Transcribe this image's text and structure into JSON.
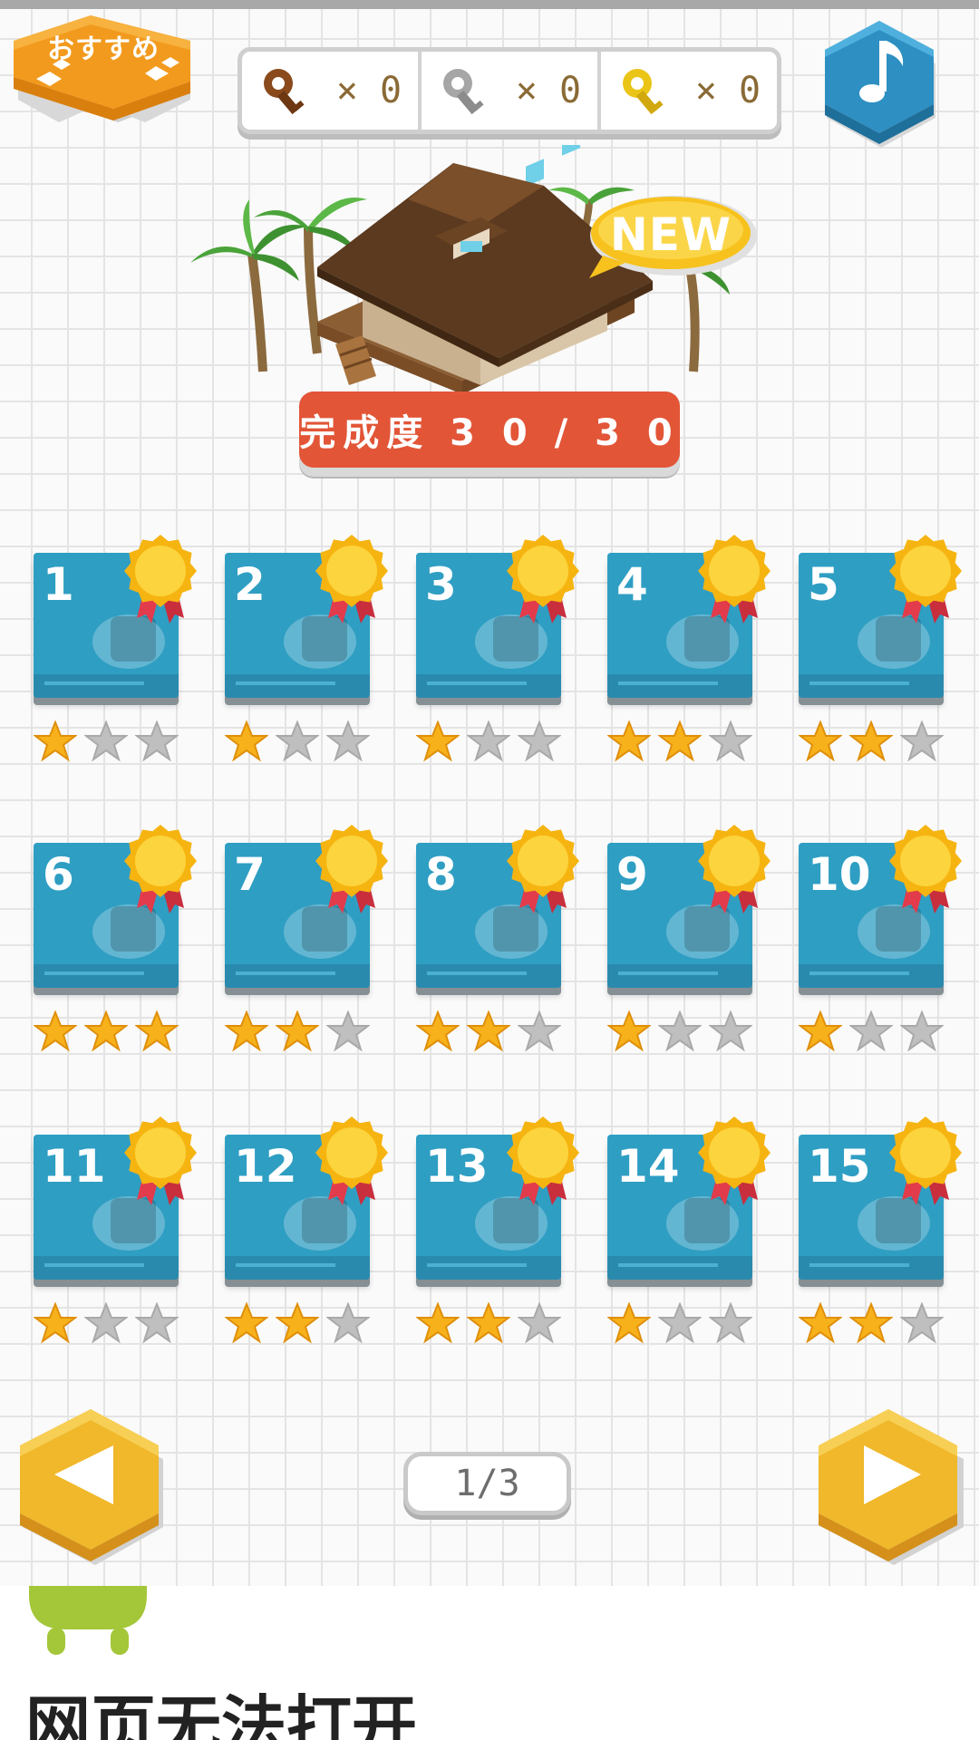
{
  "header": {
    "recommend_label": "おすすめ",
    "keys": [
      {
        "name": "bronze-key",
        "color": "#8a4a1c",
        "count": "× 0"
      },
      {
        "name": "silver-key",
        "color": "#9a9a9a",
        "count": "× 0"
      },
      {
        "name": "gold-key",
        "color": "#e8c21a",
        "count": "× 0"
      }
    ],
    "music_icon": "music-note-icon"
  },
  "hero": {
    "new_badge": "NEW",
    "completion": "完成度 3 0 / 3 0"
  },
  "levels": [
    {
      "num": "1",
      "stars": 1,
      "item": "beach-table"
    },
    {
      "num": "2",
      "stars": 1,
      "item": "hula-dancer"
    },
    {
      "num": "3",
      "stars": 1,
      "item": "rubber-duck"
    },
    {
      "num": "4",
      "stars": 2,
      "item": "parrot-cage"
    },
    {
      "num": "5",
      "stars": 2,
      "item": "boombox"
    },
    {
      "num": "6",
      "stars": 3,
      "item": "pirate-ship"
    },
    {
      "num": "7",
      "stars": 2,
      "item": "suitcase"
    },
    {
      "num": "8",
      "stars": 2,
      "item": "surf-bench"
    },
    {
      "num": "9",
      "stars": 1,
      "item": "crab"
    },
    {
      "num": "10",
      "stars": 1,
      "item": "telescope"
    },
    {
      "num": "11",
      "stars": 1,
      "item": "jet-ski"
    },
    {
      "num": "12",
      "stars": 2,
      "item": "bbq-grill"
    },
    {
      "num": "13",
      "stars": 2,
      "item": "sand-castle"
    },
    {
      "num": "14",
      "stars": 1,
      "item": "blue-drink"
    },
    {
      "num": "15",
      "stars": 2,
      "item": "rocking-chair"
    }
  ],
  "pager": {
    "label": "1/3"
  },
  "colors": {
    "accent_orange": "#f5a623",
    "card_blue": "#2f9ec3",
    "completion_red": "#e25537",
    "star_gold": "#f7b21b",
    "star_gray": "#bfbfbf",
    "android_green": "#a4c639"
  },
  "error_page": {
    "title": "网页无法打开"
  }
}
